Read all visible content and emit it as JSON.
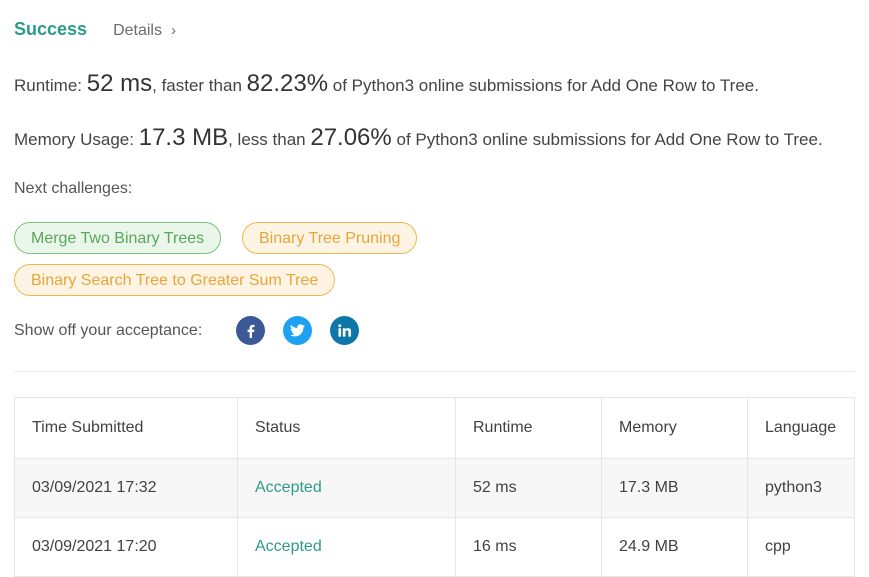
{
  "header": {
    "status": "Success",
    "details_label": "Details",
    "details_chevron": "›"
  },
  "runtime": {
    "label": "Runtime:",
    "value": "52 ms",
    "mid": ", faster than",
    "percent": "82.23%",
    "suffix": "of Python3 online submissions for Add One Row to Tree."
  },
  "memory": {
    "label": "Memory Usage:",
    "value": "17.3 MB",
    "mid": ", less than",
    "percent": "27.06%",
    "suffix": "of Python3 online submissions for Add One Row to Tree."
  },
  "next_challenges": {
    "label": "Next challenges:",
    "items": [
      {
        "label": "Merge Two Binary Trees",
        "color": "green"
      },
      {
        "label": "Binary Tree Pruning",
        "color": "orange"
      },
      {
        "label": "Binary Search Tree to Greater Sum Tree",
        "color": "orange"
      }
    ]
  },
  "share": {
    "label": "Show off your acceptance:",
    "icons": [
      "facebook-icon",
      "twitter-icon",
      "linkedin-icon"
    ]
  },
  "table": {
    "headers": [
      "Time Submitted",
      "Status",
      "Runtime",
      "Memory",
      "Language"
    ],
    "rows": [
      [
        "03/09/2021 17:32",
        "Accepted",
        "52 ms",
        "17.3 MB",
        "python3"
      ],
      [
        "03/09/2021 17:20",
        "Accepted",
        "16 ms",
        "24.9 MB",
        "cpp"
      ]
    ]
  },
  "colors": {
    "accent": "#2d9b89",
    "easy": "#5aa65a",
    "medium": "#e9a53a"
  }
}
